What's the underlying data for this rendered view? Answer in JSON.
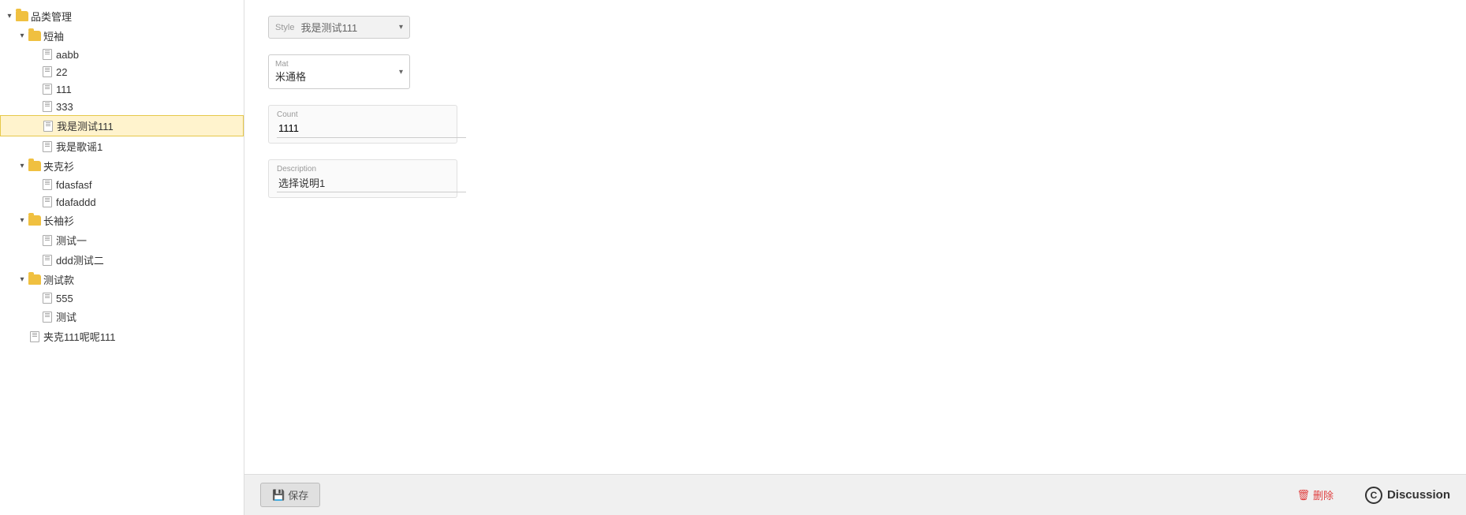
{
  "sidebar": {
    "items": [
      {
        "id": "root",
        "label": "品类管理",
        "type": "folder",
        "expanded": true,
        "indent": 1
      },
      {
        "id": "短袖",
        "label": "短袖",
        "type": "folder",
        "expanded": true,
        "indent": 2
      },
      {
        "id": "aabb",
        "label": "aabb",
        "type": "doc",
        "indent": 3
      },
      {
        "id": "22",
        "label": "22",
        "type": "doc",
        "indent": 3
      },
      {
        "id": "111",
        "label": "111",
        "type": "doc",
        "indent": 3
      },
      {
        "id": "333",
        "label": "333",
        "type": "doc",
        "indent": 3
      },
      {
        "id": "我是测试111",
        "label": "我是测试111",
        "type": "doc",
        "indent": 3,
        "selected": true
      },
      {
        "id": "我是歌谣1",
        "label": "我是歌谣1",
        "type": "doc",
        "indent": 3
      },
      {
        "id": "夹克衫",
        "label": "夹克衫",
        "type": "folder",
        "expanded": true,
        "indent": 2
      },
      {
        "id": "fdasfasf",
        "label": "fdasfasf",
        "type": "doc",
        "indent": 3
      },
      {
        "id": "fdafaddd",
        "label": "fdafaddd",
        "type": "doc",
        "indent": 3
      },
      {
        "id": "长袖衫",
        "label": "长袖衫",
        "type": "folder",
        "expanded": true,
        "indent": 2
      },
      {
        "id": "测试一",
        "label": "测试一",
        "type": "doc",
        "indent": 3
      },
      {
        "id": "ddd测试二",
        "label": "ddd测试二",
        "type": "doc",
        "indent": 3
      },
      {
        "id": "测试款",
        "label": "测试款",
        "type": "folder",
        "expanded": true,
        "indent": 2
      },
      {
        "id": "555",
        "label": "555",
        "type": "doc",
        "indent": 3
      },
      {
        "id": "测试",
        "label": "测试",
        "type": "doc",
        "indent": 3
      },
      {
        "id": "夹克111呢呢111",
        "label": "夹克111呢呢111",
        "type": "doc",
        "indent": 2
      }
    ]
  },
  "form": {
    "style_label": "Style",
    "style_value": "我是测试111",
    "mat_label": "Mat",
    "mat_value": "米通格",
    "count_label": "Count",
    "count_value": "1111",
    "description_label": "Description",
    "description_value": "选择说明1"
  },
  "footer": {
    "save_label": "保存",
    "delete_label": "删除",
    "discussion_label": "Discussion"
  }
}
